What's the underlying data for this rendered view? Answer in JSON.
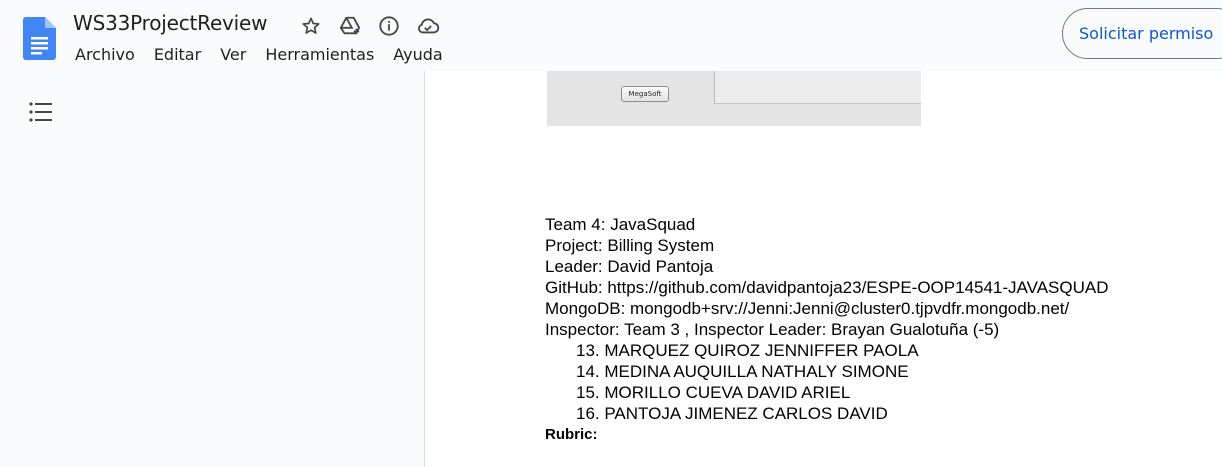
{
  "header": {
    "doc_title": "WS33ProjectReview",
    "menu": [
      "Archivo",
      "Editar",
      "Ver",
      "Herramientas",
      "Ayuda"
    ],
    "request_button": "Solicitar permiso",
    "icons": [
      "star-icon",
      "drive-add-icon",
      "info-icon",
      "cloud-icon"
    ]
  },
  "sidebar": {
    "outline_icon": "outline-list-icon"
  },
  "embedded_image": {
    "button_label": "MegaSoft"
  },
  "document": {
    "team": "Team 4: JavaSquad",
    "project": "Project: Billing System",
    "leader": "Leader: David Pantoja",
    "github": "GitHub: https://github.com/davidpantoja23/ESPE-OOP14541-JAVASQUAD",
    "mongodb": "MongoDB: mongodb+srv://Jenni:Jenni@cluster0.tjpvdfr.mongodb.net/",
    "inspector": "Inspector: Team 3 , Inspector Leader: Brayan Gualotuña (-5)",
    "members": [
      "13. MARQUEZ QUIROZ JENNIFFER PAOLA",
      "14. MEDINA AUQUILLA NATHALY SIMONE",
      "15. MORILLO CUEVA DAVID ARIEL",
      "16. PANTOJA JIMENEZ CARLOS DAVID"
    ],
    "rubric": "Rubric:"
  }
}
